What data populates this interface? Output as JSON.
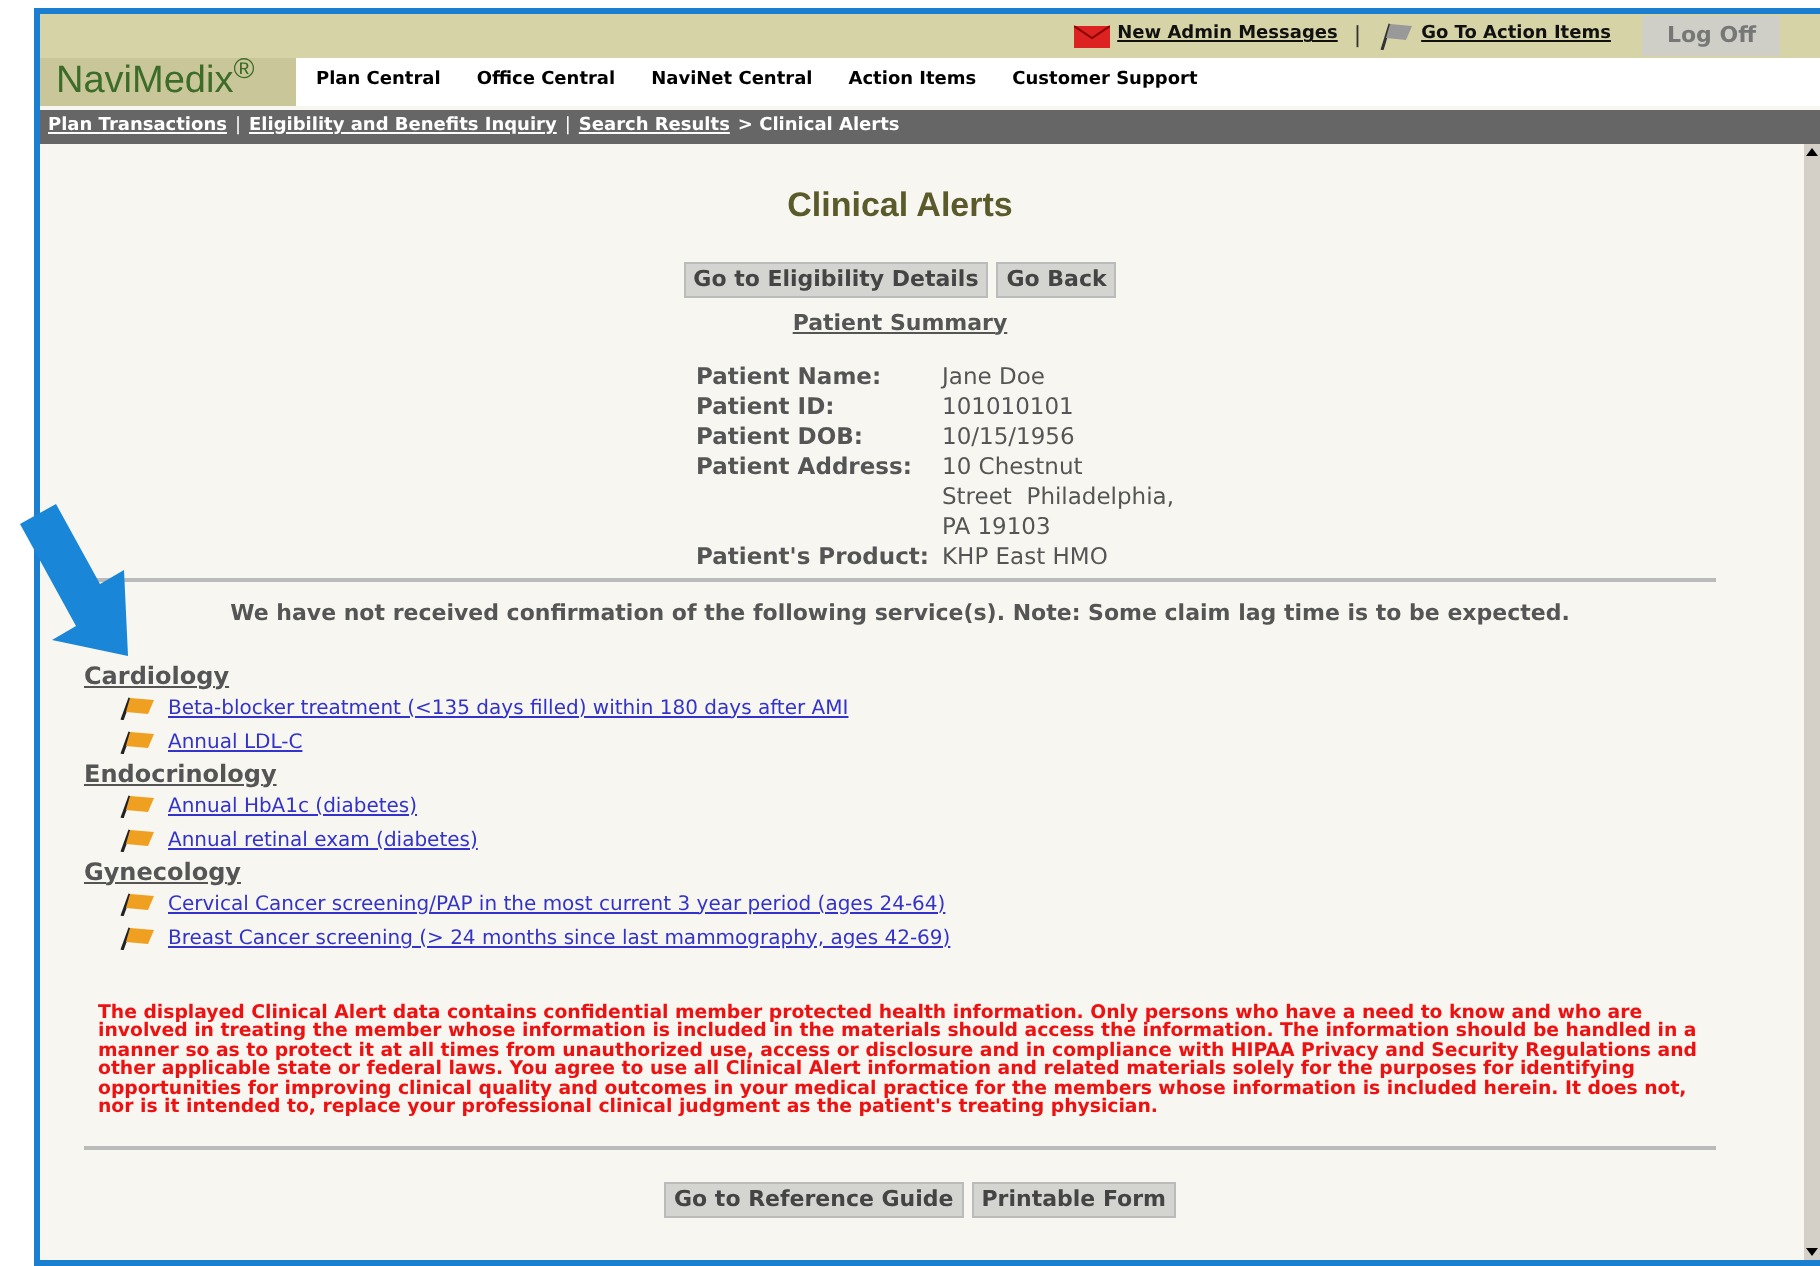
{
  "header": {
    "links": [
      "New Admin Messages",
      "Go To Action Items"
    ],
    "separator": "|",
    "logoff": "Log Off"
  },
  "logo": "NaviMedix$^{®}$",
  "nav": [
    "Plan Central",
    "Office Central",
    "NaviNet Central",
    "Action Items",
    "Customer Support"
  ],
  "breadcrumb": {
    "links": [
      "Plan Transactions",
      "Eligibility and Benefits Inquiry",
      "Search Results"
    ],
    "separator": "|",
    "current": "> Clinical Alerts"
  },
  "title": "Clinical Alerts",
  "top_buttons": [
    "Go to Eligibility Details",
    "Go Back"
  ],
  "summary_heading": "Patient Summary",
  "patient_fields": [
    {
      "label": "Patient Name:",
      "value": [
        "Jane Doe"
      ]
    },
    {
      "label": "Patient ID:",
      "value": [
        "101010101"
      ]
    },
    {
      "label": "Patient DOB:",
      "value": [
        "10/15/1956"
      ]
    },
    {
      "label": "Patient Address:",
      "value": [
        "10 Chestnut",
        "Street  Philadelphia,",
        "PA 19103"
      ]
    },
    {
      "label": "Patient's Product:",
      "value": [
        "KHP East HMO"
      ]
    }
  ],
  "notice": "We have not received confirmation of the following service(s). Note: Some claim lag time is to be expected.",
  "categories": [
    {
      "name": "Cardiology",
      "alerts": [
        "Beta-blocker treatment (<135 days filled) within 180 days after AMI",
        "Annual LDL-C"
      ]
    },
    {
      "name": "Endocrinology",
      "alerts": [
        "Annual HbA1c (diabetes)",
        "Annual retinal exam (diabetes)"
      ]
    },
    {
      "name": "Gynecology",
      "alerts": [
        "Cervical Cancer screening/PAP in the most current 3 year period (ages 24-64)",
        "Breast Cancer screening (> 24 months since last mammography, ages 42-69)"
      ]
    }
  ],
  "disclaimer": "The displayed Clinical Alert data contains confidential member protected health information. Only persons who have a need to know and who are involved in treating the member whose information is included in the materials should access the information. The information should be handled in a manner so as to protect it at all times from unauthorized use, access or disclosure and in compliance with HIPAA Privacy and Security Regulations and other applicable state or federal laws. You agree to use all Clinical Alert information and related materials solely for the purposes for identifying opportunities for improving clinical quality and outcomes in your medical practice for the members whose information is included herein. It does not, nor is it intended to, replace your professional clinical judgment as the patient's treating physician.",
  "bottom_buttons": [
    "Go to Reference Guide",
    "Printable Form"
  ]
}
